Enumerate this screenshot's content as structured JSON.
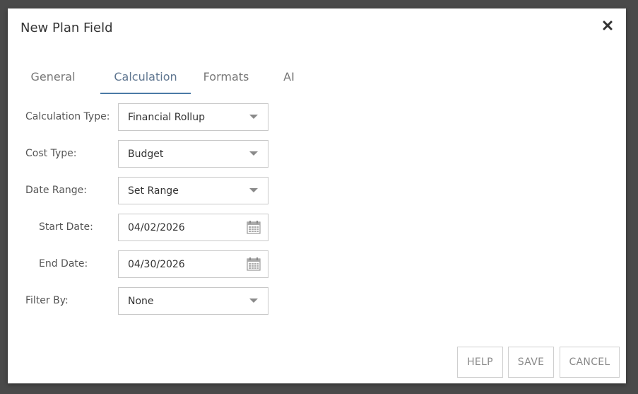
{
  "dialog": {
    "title": "New Plan Field"
  },
  "tabs": [
    {
      "label": "General"
    },
    {
      "label": "Calculation",
      "active": true
    },
    {
      "label": "Formats"
    },
    {
      "label": "AI"
    }
  ],
  "form": {
    "calculation_type": {
      "label": "Calculation Type:",
      "value": "Financial Rollup"
    },
    "cost_type": {
      "label": "Cost Type:",
      "value": "Budget"
    },
    "date_range": {
      "label": "Date Range:",
      "value": "Set Range"
    },
    "start_date": {
      "label": "Start Date:",
      "value": "04/02/2026"
    },
    "end_date": {
      "label": "End Date:",
      "value": "04/30/2026"
    },
    "filter_by": {
      "label": "Filter By:",
      "value": "None"
    }
  },
  "buttons": {
    "help": "HELP",
    "save": "SAVE",
    "cancel": "CANCEL"
  },
  "colors": {
    "accent": "#4b7aa6",
    "overlay": "#4a4a4a"
  },
  "icons": [
    "close-icon",
    "chevron-down-icon",
    "calendar-icon"
  ]
}
